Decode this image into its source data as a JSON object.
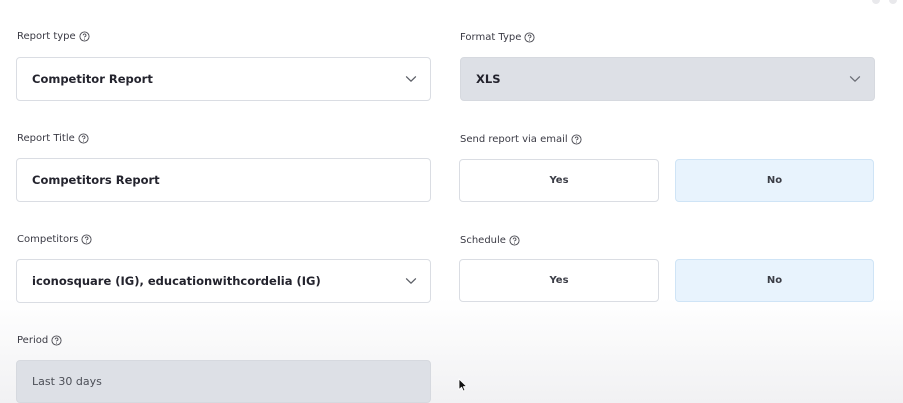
{
  "report_type": {
    "label": "Report type",
    "value": "Competitor Report"
  },
  "format_type": {
    "label": "Format Type",
    "value": "XLS"
  },
  "report_title": {
    "label": "Report Title",
    "value": "Competitors Report"
  },
  "send_email": {
    "label": "Send report via email",
    "yes_label": "Yes",
    "no_label": "No",
    "selected": "No"
  },
  "competitors": {
    "label": "Competitors",
    "value": "iconosquare (IG), educationwithcordelia (IG)"
  },
  "schedule": {
    "label": "Schedule",
    "yes_label": "Yes",
    "no_label": "No",
    "selected": "No"
  },
  "period": {
    "label": "Period",
    "value": "Last 30 days"
  },
  "colors": {
    "selected_toggle_bg": "#e8f3fd",
    "disabled_bg": "#dde0e6",
    "border": "#dadde3"
  }
}
